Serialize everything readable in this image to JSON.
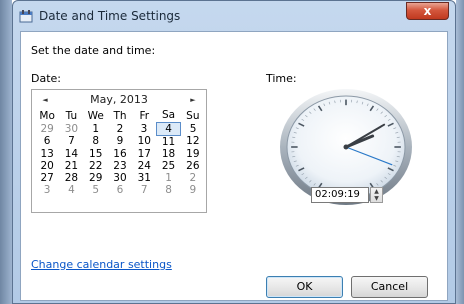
{
  "window": {
    "title": "Date and Time Settings",
    "close_label": "x"
  },
  "labels": {
    "set_date_time": "Set the date and time:",
    "date": "Date:",
    "time": "Time:"
  },
  "calendar": {
    "month_label": "May, 2013",
    "prev_label": "◄",
    "next_label": "►",
    "weekdays": [
      "Mo",
      "Tu",
      "We",
      "Th",
      "Fr",
      "Sa",
      "Su"
    ],
    "weeks": [
      [
        {
          "d": "29",
          "dim": true
        },
        {
          "d": "30",
          "dim": true
        },
        {
          "d": "1"
        },
        {
          "d": "2"
        },
        {
          "d": "3"
        },
        {
          "d": "4",
          "selected": true
        },
        {
          "d": "5"
        }
      ],
      [
        {
          "d": "6"
        },
        {
          "d": "7"
        },
        {
          "d": "8"
        },
        {
          "d": "9"
        },
        {
          "d": "10"
        },
        {
          "d": "11"
        },
        {
          "d": "12"
        }
      ],
      [
        {
          "d": "13"
        },
        {
          "d": "14"
        },
        {
          "d": "15"
        },
        {
          "d": "16"
        },
        {
          "d": "17"
        },
        {
          "d": "18"
        },
        {
          "d": "19"
        }
      ],
      [
        {
          "d": "20"
        },
        {
          "d": "21"
        },
        {
          "d": "22"
        },
        {
          "d": "23"
        },
        {
          "d": "24"
        },
        {
          "d": "25"
        },
        {
          "d": "26"
        }
      ],
      [
        {
          "d": "27"
        },
        {
          "d": "28"
        },
        {
          "d": "29"
        },
        {
          "d": "30"
        },
        {
          "d": "31"
        },
        {
          "d": "1",
          "dim": true
        },
        {
          "d": "2",
          "dim": true
        }
      ],
      [
        {
          "d": "3",
          "dim": true
        },
        {
          "d": "4",
          "dim": true
        },
        {
          "d": "5",
          "dim": true
        },
        {
          "d": "6",
          "dim": true
        },
        {
          "d": "7",
          "dim": true
        },
        {
          "d": "8",
          "dim": true
        },
        {
          "d": "9",
          "dim": true
        }
      ]
    ]
  },
  "clock": {
    "hour": 2,
    "minute": 9,
    "second": 19
  },
  "time_field": {
    "value": "02:09:19",
    "spin_up": "▲",
    "spin_down": "▼"
  },
  "link": {
    "change_calendar": "Change calendar settings"
  },
  "buttons": {
    "ok": "OK",
    "cancel": "Cancel"
  },
  "colors": {
    "title_bar": "#b2cae6",
    "close_button": "#c0391f",
    "link": "#0a56c8",
    "selected_day": "#dceaf8"
  }
}
